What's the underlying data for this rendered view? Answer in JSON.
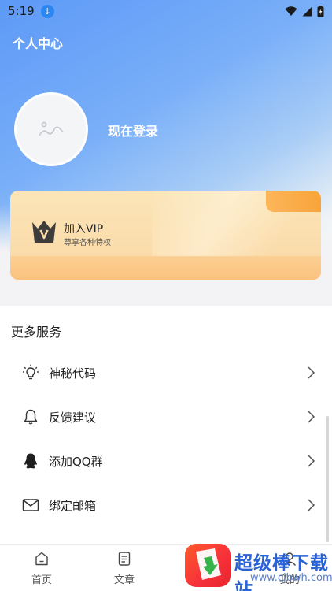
{
  "status_bar": {
    "time": "5:19",
    "icons": [
      "download-icon",
      "wifi-icon",
      "signal-icon",
      "battery-icon"
    ]
  },
  "header": {
    "title": "个人中心"
  },
  "profile": {
    "login_label": "现在登录",
    "avatar_icon": "image-placeholder-icon"
  },
  "vip": {
    "title": "加入VIP",
    "subtitle": "尊享各种特权",
    "icon": "crown-icon"
  },
  "services": {
    "title": "更多服务",
    "items": [
      {
        "label": "神秘代码",
        "icon": "lightbulb-icon"
      },
      {
        "label": "反馈建议",
        "icon": "bell-icon"
      },
      {
        "label": "添加QQ群",
        "icon": "qq-icon"
      },
      {
        "label": "绑定邮箱",
        "icon": "mail-icon"
      }
    ]
  },
  "bottom_nav": {
    "items": [
      {
        "label": "首页",
        "icon": "home-icon"
      },
      {
        "label": "文章",
        "icon": "article-icon"
      },
      {
        "label": "我的",
        "icon": "user-icon"
      }
    ]
  },
  "watermark": {
    "brand": "超级棒下载站",
    "url": "www.cjbwh.com"
  },
  "colors": {
    "hero_blue": "#5d99f7",
    "vip_gold": "#fbdcab",
    "vip_orange": "#f8a43a",
    "watermark_red": "#f5303a",
    "watermark_blue": "#2a63d6"
  }
}
